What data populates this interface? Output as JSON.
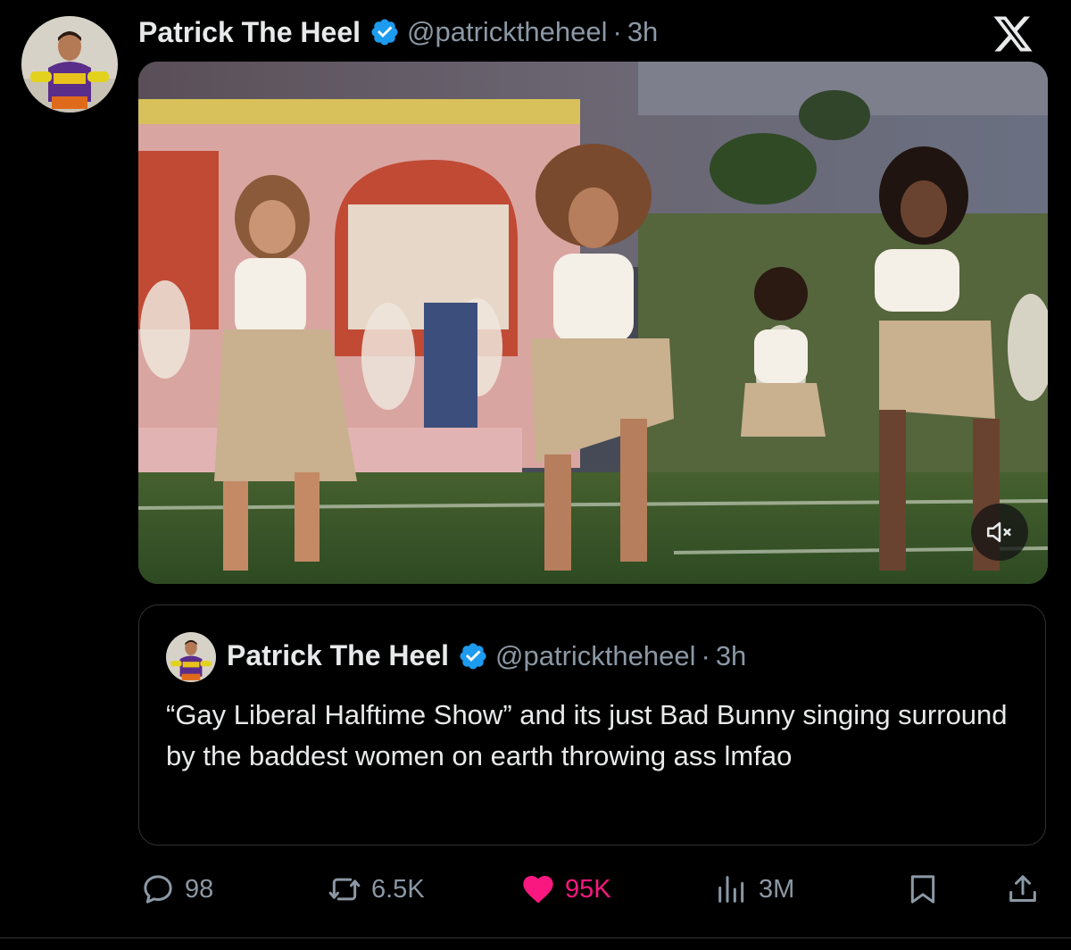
{
  "tweet": {
    "author_name": "Patrick The Heel",
    "handle": "@patricktheheel",
    "separator": "·",
    "time": "3h"
  },
  "quoted": {
    "author_name": "Patrick The Heel",
    "handle": "@patricktheheel",
    "separator": "·",
    "time": "3h",
    "text": "“Gay Liberal Halftime Show” and its just Bad Bunny singing surround by the baddest women on earth throwing ass lmfao"
  },
  "actions": {
    "replies": "98",
    "reposts": "6.5K",
    "likes": "95K",
    "views": "3M"
  },
  "icons": {
    "verified": "verified-badge-icon",
    "logo": "x-logo-icon",
    "mute": "speaker-muted-icon",
    "reply": "reply-bubble-icon",
    "repost": "repost-arrows-icon",
    "like": "heart-filled-icon",
    "views": "bar-chart-icon",
    "bookmark": "bookmark-icon",
    "share": "share-upload-icon"
  },
  "colors": {
    "background": "#000000",
    "primary_text": "#e7e9ea",
    "secondary_text": "#8b98a5",
    "verified_blue": "#1d9bf0",
    "like_pink": "#f91880",
    "border": "#2f3336"
  }
}
